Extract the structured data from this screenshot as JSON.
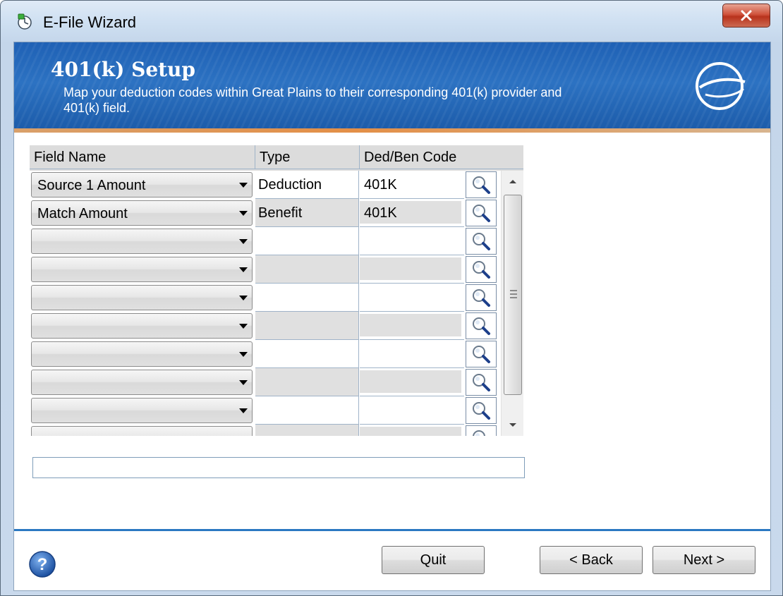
{
  "window": {
    "title": "E-File Wizard",
    "close_glyph": "X"
  },
  "banner": {
    "title": "401(k) Setup",
    "description": "Map your deduction codes within Great Plains to their corresponding 401(k) provider and 401(k) field."
  },
  "grid": {
    "headers": [
      "Field Name",
      "Type",
      "Ded/Ben Code"
    ],
    "rows": [
      {
        "field_name": "Source 1 Amount",
        "type": "Deduction",
        "code": "401K"
      },
      {
        "field_name": "Match Amount",
        "type": "Benefit",
        "code": "401K"
      },
      {
        "field_name": "",
        "type": "",
        "code": ""
      },
      {
        "field_name": "",
        "type": "",
        "code": ""
      },
      {
        "field_name": "",
        "type": "",
        "code": ""
      },
      {
        "field_name": "",
        "type": "",
        "code": ""
      },
      {
        "field_name": "",
        "type": "",
        "code": ""
      },
      {
        "field_name": "",
        "type": "",
        "code": ""
      },
      {
        "field_name": "",
        "type": "",
        "code": ""
      },
      {
        "field_name": "",
        "type": "",
        "code": ""
      }
    ]
  },
  "status_text": "",
  "buttons": {
    "quit": "Quit",
    "back": "< Back",
    "next": "Next >"
  },
  "colors": {
    "banner_blue": "#1f61b5",
    "banner_accent": "#e38f47",
    "footer_line": "#2b78c2"
  },
  "icons": {
    "app": "wizard-app-icon",
    "close": "close-icon",
    "lookup": "magnifier-icon",
    "help": "help-icon",
    "logo": "e-logo-icon"
  }
}
